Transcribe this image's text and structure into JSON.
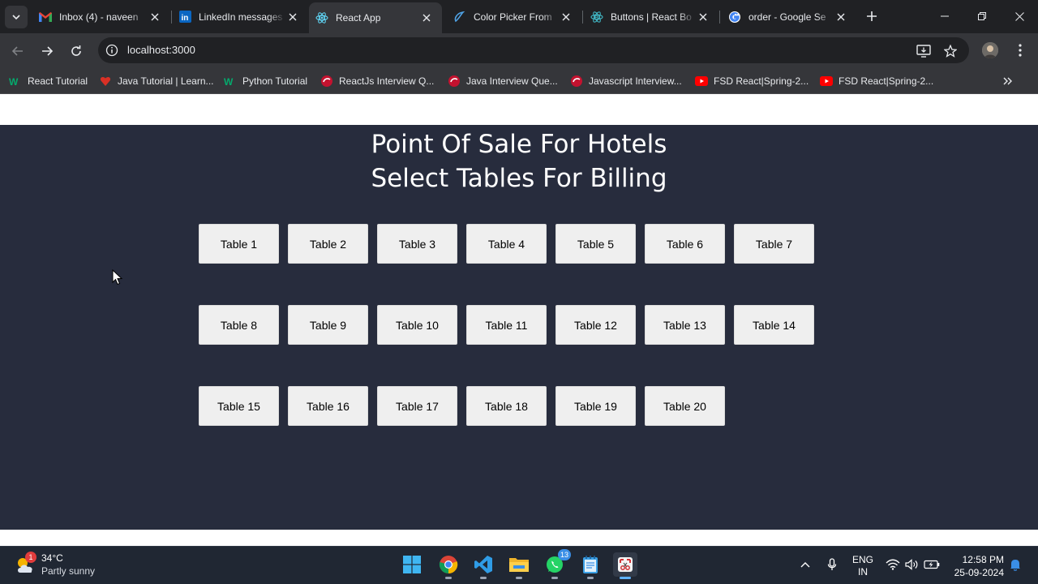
{
  "browser": {
    "tabs": [
      {
        "title": "Inbox (4) - naveen",
        "icon": "gmail-icon",
        "active": false
      },
      {
        "title": "LinkedIn messages",
        "icon": "linkedin-icon",
        "active": false
      },
      {
        "title": "React App",
        "icon": "react-icon",
        "active": true
      },
      {
        "title": "Color Picker From",
        "icon": "color-picker-icon",
        "active": false
      },
      {
        "title": "Buttons | React Bo",
        "icon": "react-bootstrap-icon",
        "active": false
      },
      {
        "title": "order - Google Se",
        "icon": "google-icon",
        "active": false
      }
    ],
    "url": "localhost:3000",
    "bookmarks": [
      {
        "label": "React Tutorial",
        "icon": "w3schools-icon"
      },
      {
        "label": "Java Tutorial | Learn...",
        "icon": "heart-icon"
      },
      {
        "label": "Python Tutorial",
        "icon": "w3schools-icon"
      },
      {
        "label": "ReactJs Interview Q...",
        "icon": "scaler-icon"
      },
      {
        "label": "Java Interview Que...",
        "icon": "scaler-icon"
      },
      {
        "label": "Javascript Interview...",
        "icon": "scaler-icon"
      },
      {
        "label": "FSD React|Spring-2...",
        "icon": "youtube-icon"
      },
      {
        "label": "FSD React|Spring-2...",
        "icon": "youtube-icon"
      }
    ]
  },
  "page": {
    "title": "Point Of Sale For Hotels",
    "subtitle": "Select Tables For Billing",
    "tables": [
      "Table 1",
      "Table 2",
      "Table 3",
      "Table 4",
      "Table 5",
      "Table 6",
      "Table 7",
      "Table 8",
      "Table 9",
      "Table 10",
      "Table 11",
      "Table 12",
      "Table 13",
      "Table 14",
      "Table 15",
      "Table 16",
      "Table 17",
      "Table 18",
      "Table 19",
      "Table 20"
    ]
  },
  "taskbar": {
    "weather": {
      "temp": "34°C",
      "desc": "Partly sunny",
      "badge": "1"
    },
    "apps": [
      {
        "name": "start-button",
        "badge": ""
      },
      {
        "name": "chrome-app",
        "badge": ""
      },
      {
        "name": "vscode-app",
        "badge": ""
      },
      {
        "name": "file-explorer-app",
        "badge": ""
      },
      {
        "name": "whatsapp-app",
        "badge": "13"
      },
      {
        "name": "notepad-app",
        "badge": ""
      },
      {
        "name": "snipping-tool-app",
        "badge": ""
      }
    ],
    "language": {
      "line1": "ENG",
      "line2": "IN"
    },
    "time": "12:58 PM",
    "date": "25-09-2024"
  },
  "colors": {
    "app_background": "#272c3d",
    "button_background": "#efefef",
    "chrome_dark": "#202124",
    "chrome_toolbar": "#35363a"
  }
}
